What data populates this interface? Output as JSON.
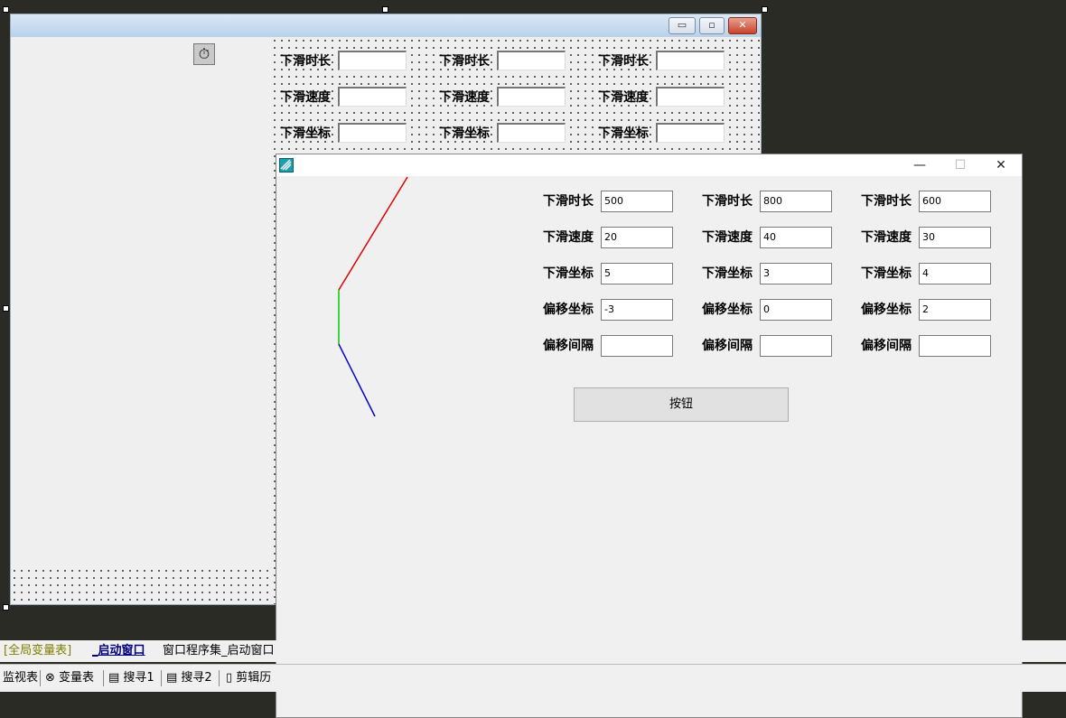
{
  "designer": {
    "labels": [
      [
        "下滑时长",
        "下滑时长",
        "下滑时长"
      ],
      [
        "下滑速度",
        "下滑速度",
        "下滑速度"
      ],
      [
        "下滑坐标",
        "下滑坐标",
        "下滑坐标"
      ]
    ],
    "min_glyph": "▭",
    "max_glyph": "▫",
    "close_glyph": "✕",
    "timer_icon": "⏱"
  },
  "runtime": {
    "rows": [
      {
        "label": "下滑时长",
        "values": [
          "500",
          "800",
          "600"
        ]
      },
      {
        "label": "下滑速度",
        "values": [
          "20",
          "40",
          "30"
        ]
      },
      {
        "label": "下滑坐标",
        "values": [
          "5",
          "3",
          "4"
        ]
      },
      {
        "label": "偏移坐标",
        "values": [
          "-3",
          "0",
          "2"
        ]
      },
      {
        "label": "偏移间隔",
        "values": [
          "",
          "",
          ""
        ]
      }
    ],
    "button_label": "按钮",
    "min_glyph": "—",
    "max_glyph": "☐",
    "close_glyph": "✕",
    "line_colors": [
      "#e00000",
      "#00cc00",
      "#0000cc"
    ]
  },
  "tabs": [
    "[全局变量表]",
    "_启动窗口",
    "窗口程序集_启动窗口"
  ],
  "toolbar": [
    "监视表",
    "变量表",
    "搜寻1",
    "搜寻2",
    "剪辑历"
  ]
}
